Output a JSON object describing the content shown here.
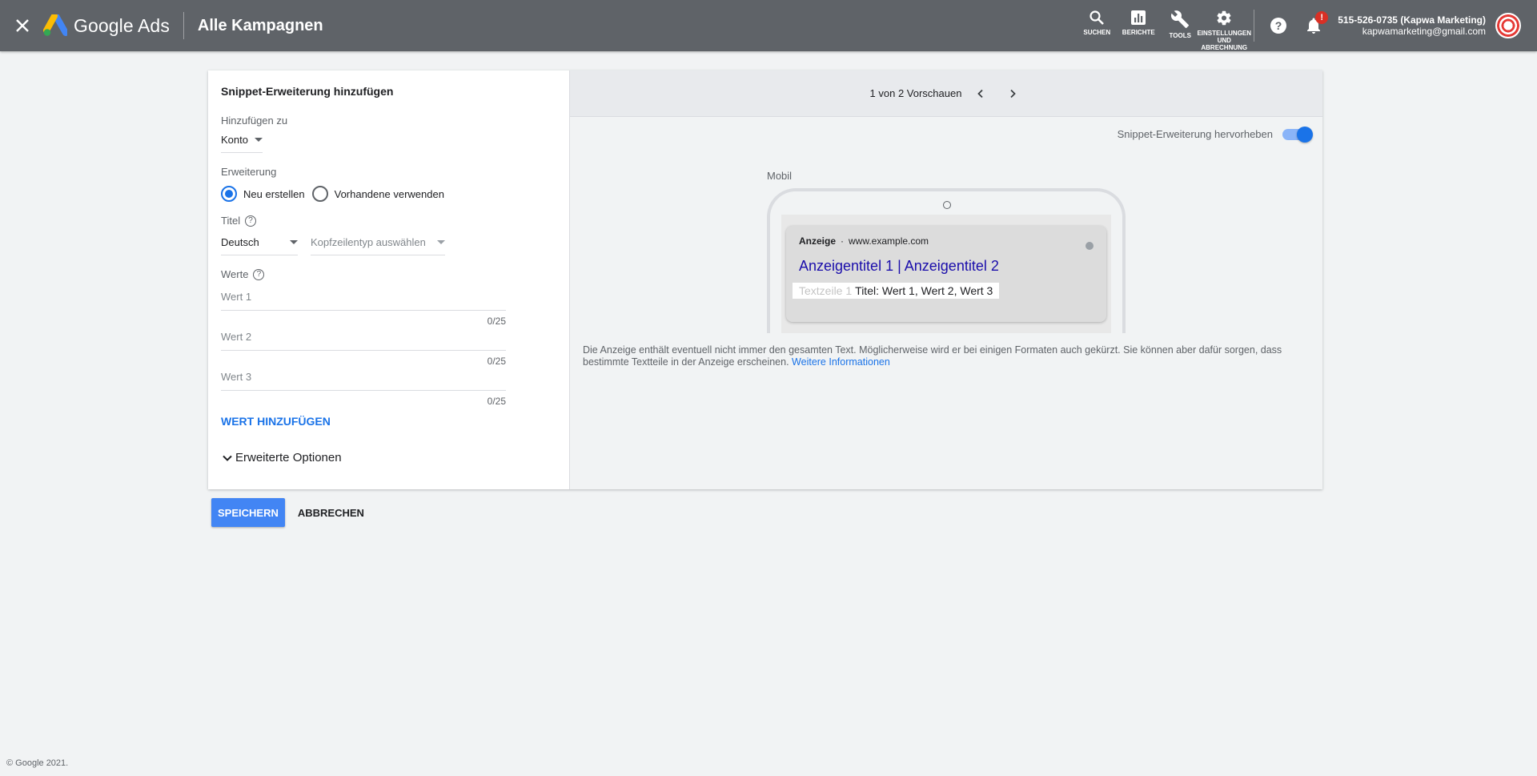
{
  "header": {
    "logo_text": "Google Ads",
    "page_title": "Alle Kampagnen",
    "tools": [
      {
        "label": "SUCHEN",
        "icon": "search-icon"
      },
      {
        "label": "BERICHTE",
        "icon": "reports-icon"
      },
      {
        "label": "TOOLS",
        "icon": "wrench-icon"
      },
      {
        "label": "EINSTELLUNGEN UND ABRECHNUNG",
        "icon": "gear-icon"
      }
    ],
    "notification_badge": "!",
    "account_name": "515-526-0735 (Kapwa Marketing)",
    "account_email": "kapwamarketing@gmail.com"
  },
  "form": {
    "heading": "Snippet-Erweiterung hinzufügen",
    "add_to_label": "Hinzufügen zu",
    "add_to_value": "Konto",
    "extension_label": "Erweiterung",
    "radio_new": "Neu erstellen",
    "radio_existing": "Vorhandene verwenden",
    "title_label": "Titel",
    "language_value": "Deutsch",
    "header_type_placeholder": "Kopfzeilentyp auswählen",
    "values_label": "Werte",
    "values": [
      {
        "placeholder": "Wert 1",
        "counter": "0/25"
      },
      {
        "placeholder": "Wert 2",
        "counter": "0/25"
      },
      {
        "placeholder": "Wert 3",
        "counter": "0/25"
      }
    ],
    "add_value_link": "WERT HINZUFÜGEN",
    "advanced_options": "Erweiterte Optionen"
  },
  "preview": {
    "pager_text": "1 von 2 Vorschauen",
    "toggle_label": "Snippet-Erweiterung hervorheben",
    "device_label": "Mobil",
    "ad_label": "Anzeige",
    "ad_separator": "·",
    "ad_url": "www.example.com",
    "ad_title": "Anzeigentitel 1 | Anzeigentitel 2",
    "ad_snippet_ghost": "Textzeile 1",
    "ad_snippet": "Titel: Wert 1, Wert 2, Wert 3",
    "disclaimer": "Die Anzeige enthält eventuell nicht immer den gesamten Text. Möglicherweise wird er bei einigen Formaten auch gekürzt. Sie können aber dafür sorgen, dass bestimmte Textteile in der Anzeige erscheinen.",
    "more_info_link": "Weitere Informationen"
  },
  "actions": {
    "save": "SPEICHERN",
    "cancel": "ABBRECHEN"
  },
  "footer": {
    "copyright": "© Google 2021."
  },
  "colors": {
    "header_bg": "#5f6368",
    "accent": "#1a73e8",
    "save_button": "#4285f4",
    "ad_title": "#1a0dab",
    "badge": "#d93025"
  }
}
